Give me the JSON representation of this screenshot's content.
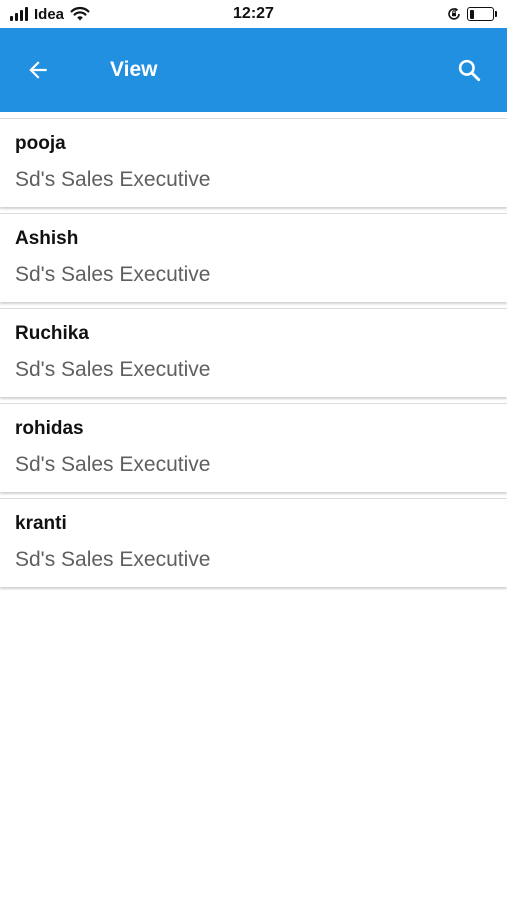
{
  "status_bar": {
    "carrier": "Idea",
    "time": "12:27",
    "signal_bars": 4,
    "battery_level": 0.2,
    "icons": [
      "signal-icon",
      "wifi-icon",
      "rotation-lock-icon",
      "battery-icon"
    ]
  },
  "app_bar": {
    "title": "View",
    "color": "#2290e1",
    "back_icon": "arrow-left-icon",
    "search_icon": "search-icon"
  },
  "list": {
    "items": [
      {
        "name": "pooja",
        "role": "Sd's Sales Executive"
      },
      {
        "name": "Ashish",
        "role": "Sd's Sales Executive"
      },
      {
        "name": "Ruchika",
        "role": "Sd's Sales Executive"
      },
      {
        "name": "rohidas",
        "role": "Sd's Sales Executive"
      },
      {
        "name": "kranti",
        "role": "Sd's Sales Executive"
      }
    ]
  }
}
